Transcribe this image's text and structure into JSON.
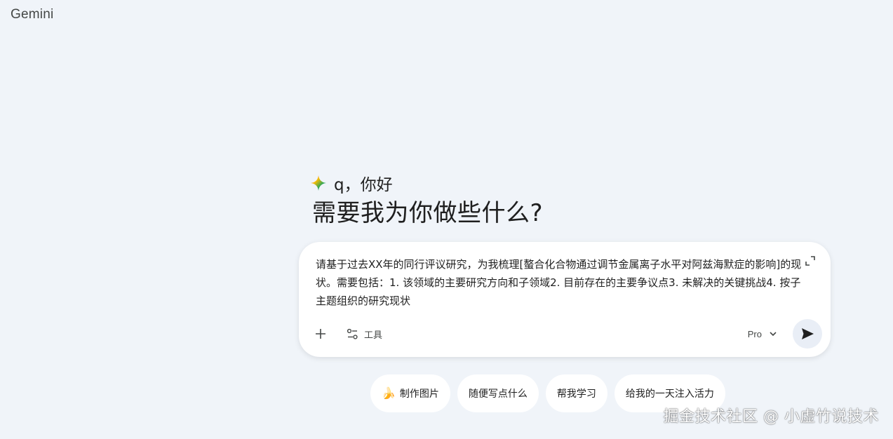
{
  "app": {
    "brand": "Gemini"
  },
  "greeting": {
    "text": "q，你好",
    "icon": "gemini-spark-icon"
  },
  "headline": "需要我为你做些什么?",
  "composer": {
    "prompt_text": "请基于过去XX年的同行评议研究，为我梳理[螯合化合物通过调节金属离子水平对阿兹海默症的影响]的现状。需要包括：1. 该领域的主要研究方向和子领域2. 目前存在的主要争议点3. 未解决的关键挑战4. 按子主题组织的研究现状",
    "tools_label": "工具",
    "model_label": "Pro",
    "icons": {
      "expand": "expand-icon",
      "plus": "plus-icon",
      "tools": "tools-icon",
      "dropdown": "chevron-down-icon",
      "send": "send-icon"
    }
  },
  "chips": [
    {
      "label": "制作图片",
      "icon": "banana-icon"
    },
    {
      "label": "随便写点什么"
    },
    {
      "label": "帮我学习"
    },
    {
      "label": "给我的一天注入活力"
    }
  ],
  "watermark": "掘金技术社区 @ 小虚竹说技术",
  "colors": {
    "background": "#f0f4f9",
    "surface": "#ffffff",
    "text": "#1f1f1f",
    "muted": "#444746",
    "send_bg": "#e9eef6"
  }
}
